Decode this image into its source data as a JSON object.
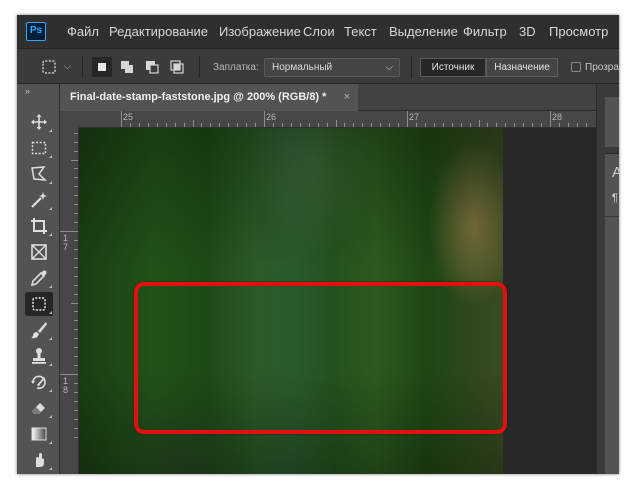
{
  "app": {
    "logo": "Ps",
    "menu": [
      "Файл",
      "Редактирование",
      "Изображение",
      "Слои",
      "Текст",
      "Выделение",
      "Фильтр",
      "3D",
      "Просмотр"
    ]
  },
  "options_bar": {
    "patch_label": "Заплатка:",
    "patch_mode": "Нормальный",
    "source_label": "Источник",
    "destination_label": "Назначение",
    "transparent_label": "Прозрачный",
    "active_segment": "Источник"
  },
  "document_tab": {
    "title": "Final-date-stamp-faststone.jpg @ 200% (RGB/8) *",
    "close_glyph": "×"
  },
  "rulers": {
    "top": [
      "25",
      "26",
      "27",
      "28"
    ],
    "left": [
      {
        "top": "1",
        "bottom": "7"
      },
      {
        "top": "1",
        "bottom": "8"
      }
    ]
  },
  "toolbar": {
    "collapse_glyph": "»",
    "tools": [
      "move-tool",
      "marquee-tool",
      "lasso-tool",
      "magic-wand-tool",
      "crop-tool",
      "frame-tool",
      "eyedropper-tool",
      "patch-tool",
      "brush-tool",
      "clone-stamp-tool",
      "history-brush-tool",
      "eraser-tool",
      "gradient-tool",
      "smudge-tool"
    ],
    "active_tool": "patch-tool"
  },
  "right_panel": {
    "letter": "A",
    "pilcrow": "¶"
  },
  "colors": {
    "highlight": "#e21010",
    "ps_blue": "#31a8ff",
    "ui_dark": "#2f2f2f",
    "ui_mid": "#535353"
  }
}
